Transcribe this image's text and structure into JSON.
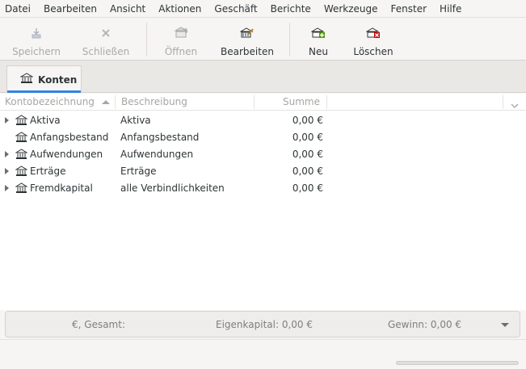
{
  "menubar": {
    "items": [
      "Datei",
      "Bearbeiten",
      "Ansicht",
      "Aktionen",
      "Geschäft",
      "Berichte",
      "Werkzeuge",
      "Fenster",
      "Hilfe"
    ]
  },
  "toolbar": {
    "save_label": "Speichern",
    "close_label": "Schließen",
    "open_label": "Öffnen",
    "edit_label": "Bearbeiten",
    "new_label": "Neu",
    "delete_label": "Löschen"
  },
  "tabs": [
    {
      "label": "Konten",
      "active": true
    }
  ],
  "columns": {
    "name": "Kontobezeichnung",
    "description": "Beschreibung",
    "total": "Summe"
  },
  "accounts": [
    {
      "name": "Aktiva",
      "description": "Aktiva",
      "total": "0,00 €",
      "expandable": true
    },
    {
      "name": "Anfangsbestand",
      "description": "Anfangsbestand",
      "total": "0,00 €",
      "expandable": false
    },
    {
      "name": "Aufwendungen",
      "description": "Aufwendungen",
      "total": "0,00 €",
      "expandable": true
    },
    {
      "name": "Erträge",
      "description": "Erträge",
      "total": "0,00 €",
      "expandable": true
    },
    {
      "name": "Fremdkapital",
      "description": "alle Verbindlichkeiten",
      "total": "0,00 €",
      "expandable": true
    }
  ],
  "summary": {
    "currency_total": "€, Gesamt:",
    "equity": "Eigenkapital: 0,00 €",
    "profit": "Gewinn: 0,00 €"
  },
  "colors": {
    "accent": "#3584e4",
    "disabled_text": "#a9aaa8"
  }
}
